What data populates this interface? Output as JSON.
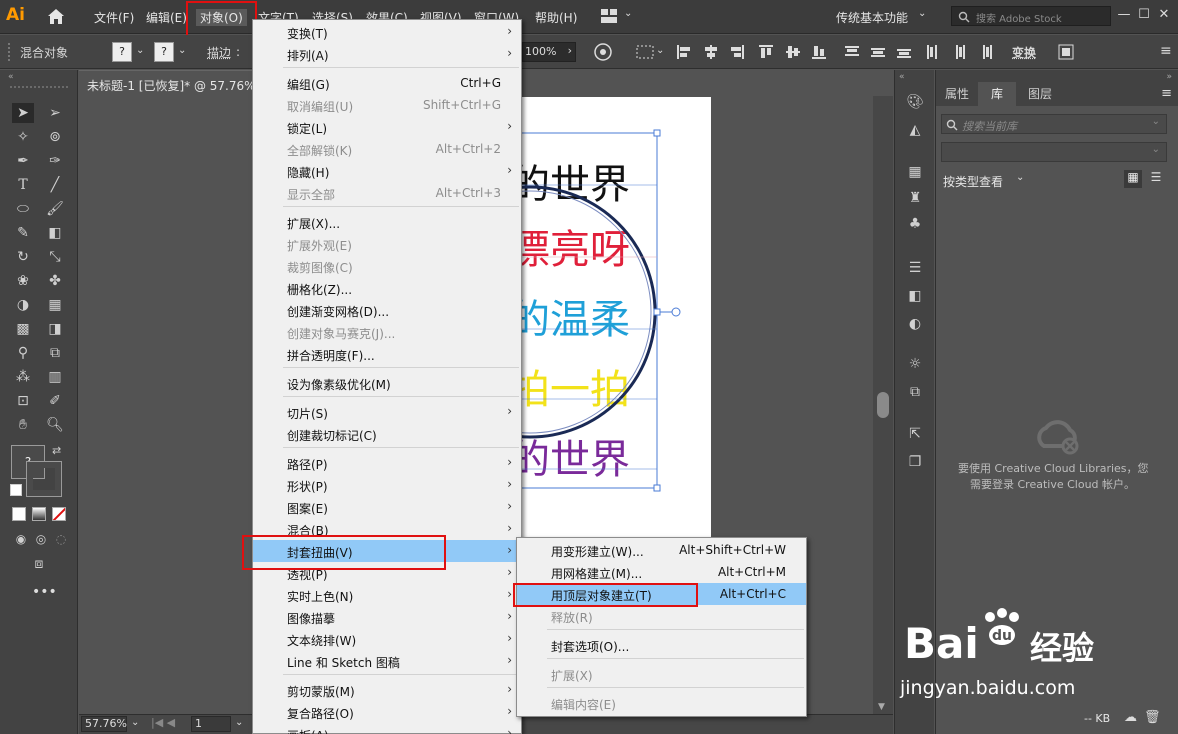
{
  "app": {
    "logo_text": "Ai",
    "accent_color": "#ff9a00"
  },
  "menubar": {
    "items": [
      "文件(F)",
      "编辑(E)",
      "对象(O)",
      "文字(T)",
      "选择(S)",
      "效果(C)",
      "视图(V)",
      "窗口(W)",
      "帮助(H)"
    ],
    "workspace": "传统基本功能",
    "stock_placeholder": "搜索 Adobe Stock"
  },
  "control": {
    "label": "混合对象",
    "stroke_label": "描边",
    "question_mark": "?",
    "opacity": "100%",
    "transform": "变换"
  },
  "document": {
    "tab_title": "未标题-1 [已恢复]* @ 57.76%",
    "zoom": "57.76%",
    "artboard_num": "1",
    "art_lines": [
      {
        "text": "的世界",
        "color": "#111111"
      },
      {
        "text": "漂亮呀",
        "color": "#e0203a"
      },
      {
        "text": "的温柔",
        "color": "#1fa0d8"
      },
      {
        "text": "拍一拍",
        "color": "#f2e21a"
      },
      {
        "text": "的世界",
        "color": "#7a2a9a"
      }
    ]
  },
  "object_menu": {
    "items": [
      {
        "label": "变换(T)",
        "shortcut": "",
        "submenu": true,
        "disabled": false
      },
      {
        "label": "排列(A)",
        "shortcut": "",
        "submenu": true,
        "disabled": false
      },
      {
        "sep": true
      },
      {
        "label": "编组(G)",
        "shortcut": "Ctrl+G",
        "submenu": false,
        "disabled": false
      },
      {
        "label": "取消编组(U)",
        "shortcut": "Shift+Ctrl+G",
        "submenu": false,
        "disabled": true
      },
      {
        "label": "锁定(L)",
        "shortcut": "",
        "submenu": true,
        "disabled": false
      },
      {
        "label": "全部解锁(K)",
        "shortcut": "Alt+Ctrl+2",
        "submenu": false,
        "disabled": true
      },
      {
        "label": "隐藏(H)",
        "shortcut": "",
        "submenu": true,
        "disabled": false
      },
      {
        "label": "显示全部",
        "shortcut": "Alt+Ctrl+3",
        "submenu": false,
        "disabled": true
      },
      {
        "sep": true
      },
      {
        "label": "扩展(X)...",
        "shortcut": "",
        "submenu": false,
        "disabled": false
      },
      {
        "label": "扩展外观(E)",
        "shortcut": "",
        "submenu": false,
        "disabled": true
      },
      {
        "label": "裁剪图像(C)",
        "shortcut": "",
        "submenu": false,
        "disabled": true
      },
      {
        "label": "栅格化(Z)...",
        "shortcut": "",
        "submenu": false,
        "disabled": false
      },
      {
        "label": "创建渐变网格(D)...",
        "shortcut": "",
        "submenu": false,
        "disabled": false
      },
      {
        "label": "创建对象马赛克(J)...",
        "shortcut": "",
        "submenu": false,
        "disabled": true
      },
      {
        "label": "拼合透明度(F)...",
        "shortcut": "",
        "submenu": false,
        "disabled": false
      },
      {
        "sep": true
      },
      {
        "label": "设为像素级优化(M)",
        "shortcut": "",
        "submenu": false,
        "disabled": false
      },
      {
        "sep": true
      },
      {
        "label": "切片(S)",
        "shortcut": "",
        "submenu": true,
        "disabled": false
      },
      {
        "label": "创建裁切标记(C)",
        "shortcut": "",
        "submenu": false,
        "disabled": false
      },
      {
        "sep": true
      },
      {
        "label": "路径(P)",
        "shortcut": "",
        "submenu": true,
        "disabled": false
      },
      {
        "label": "形状(P)",
        "shortcut": "",
        "submenu": true,
        "disabled": false
      },
      {
        "label": "图案(E)",
        "shortcut": "",
        "submenu": true,
        "disabled": false
      },
      {
        "label": "混合(B)",
        "shortcut": "",
        "submenu": true,
        "disabled": false
      },
      {
        "label": "封套扭曲(V)",
        "shortcut": "",
        "submenu": true,
        "disabled": false,
        "highlight": true
      },
      {
        "label": "透视(P)",
        "shortcut": "",
        "submenu": true,
        "disabled": false
      },
      {
        "label": "实时上色(N)",
        "shortcut": "",
        "submenu": true,
        "disabled": false
      },
      {
        "label": "图像描摹",
        "shortcut": "",
        "submenu": true,
        "disabled": false
      },
      {
        "label": "文本绕排(W)",
        "shortcut": "",
        "submenu": true,
        "disabled": false
      },
      {
        "label": "Line 和 Sketch 图稿",
        "shortcut": "",
        "submenu": true,
        "disabled": false
      },
      {
        "sep": true
      },
      {
        "label": "剪切蒙版(M)",
        "shortcut": "",
        "submenu": true,
        "disabled": false
      },
      {
        "label": "复合路径(O)",
        "shortcut": "",
        "submenu": true,
        "disabled": false
      },
      {
        "label": "画板(A)",
        "shortcut": "",
        "submenu": true,
        "disabled": false
      }
    ]
  },
  "envelope_menu": {
    "items": [
      {
        "label": "用变形建立(W)...",
        "shortcut": "Alt+Shift+Ctrl+W",
        "disabled": false
      },
      {
        "label": "用网格建立(M)...",
        "shortcut": "Alt+Ctrl+M",
        "disabled": false
      },
      {
        "label": "用顶层对象建立(T)",
        "shortcut": "Alt+Ctrl+C",
        "disabled": false,
        "highlight": true
      },
      {
        "label": "释放(R)",
        "shortcut": "",
        "disabled": true
      },
      {
        "sep": true
      },
      {
        "label": "封套选项(O)...",
        "shortcut": "",
        "disabled": false
      },
      {
        "sep": true
      },
      {
        "label": "扩展(X)",
        "shortcut": "",
        "disabled": true
      },
      {
        "sep": true
      },
      {
        "label": "编辑内容(E)",
        "shortcut": "",
        "disabled": true
      }
    ]
  },
  "panel": {
    "tabs": [
      "属性",
      "库",
      "图层"
    ],
    "search_placeholder": "搜索当前库",
    "view_by": "按类型查看",
    "cc_message_1": "要使用 Creative Cloud Libraries，您",
    "cc_message_2": "需要登录 Creative Cloud 帐户。",
    "footer": "-- KB"
  },
  "watermark": {
    "brand": "Bai",
    "brand2": "经验",
    "url": "jingyan.baidu.com"
  }
}
